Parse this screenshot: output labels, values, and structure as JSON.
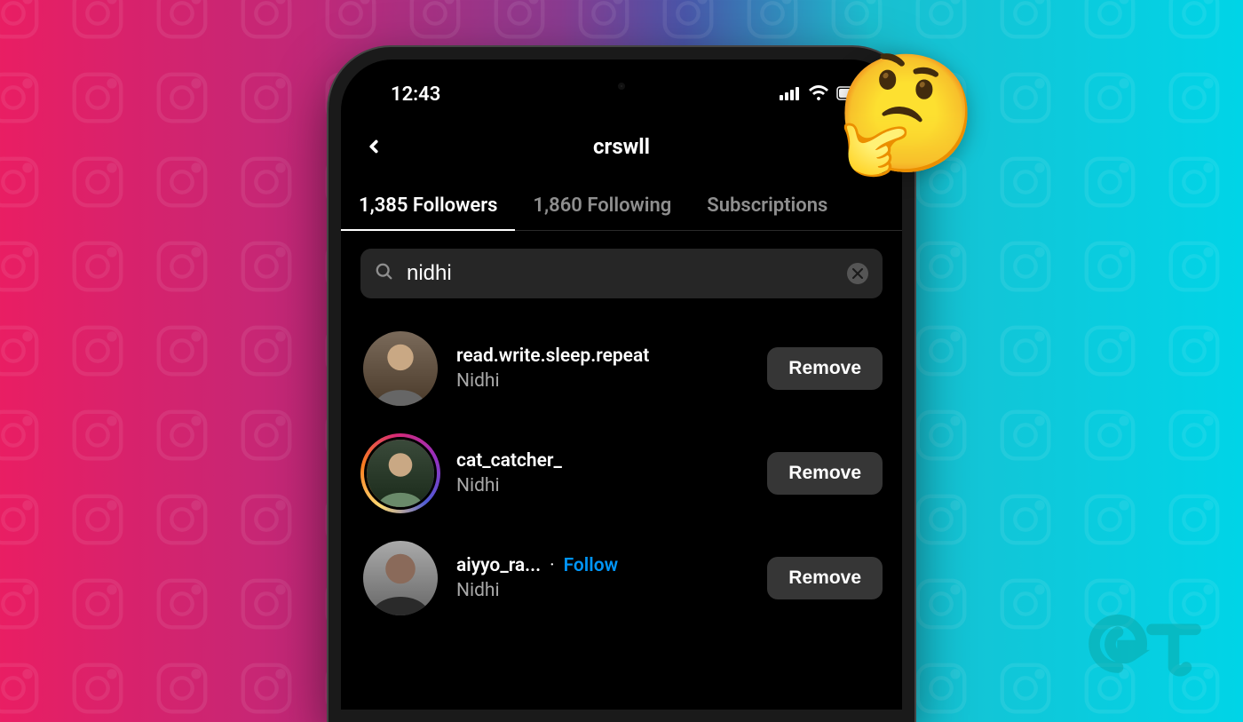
{
  "status_bar": {
    "time": "12:43"
  },
  "header": {
    "title": "crswll"
  },
  "tabs": {
    "followers": "1,385 Followers",
    "following": "1,860 Following",
    "subscriptions": "Subscriptions"
  },
  "search": {
    "value": "nidhi"
  },
  "followers": [
    {
      "username": "read.write.sleep.repeat",
      "display_name": "Nidhi",
      "has_story": false,
      "show_follow": false
    },
    {
      "username": "cat_catcher_",
      "display_name": "Nidhi",
      "has_story": true,
      "show_follow": false
    },
    {
      "username": "aiyyo_ra...",
      "display_name": "Nidhi",
      "has_story": false,
      "show_follow": true
    }
  ],
  "labels": {
    "follow": "Follow",
    "remove": "Remove",
    "dot": "·"
  },
  "emoji": "🤔",
  "logo_text": "GT"
}
